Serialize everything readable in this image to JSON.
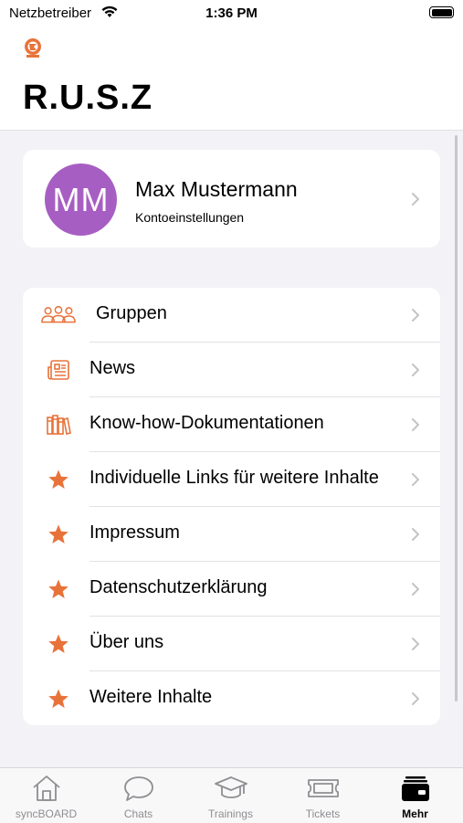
{
  "status_bar": {
    "carrier": "Netzbetreiber",
    "time": "1:36 PM"
  },
  "header": {
    "title": "R.U.S.Z"
  },
  "profile": {
    "initials": "MM",
    "name": "Max Mustermann",
    "subtitle": "Kontoeinstellungen",
    "avatar_color": "#a75ec2"
  },
  "menu": {
    "accent_color": "#e8733a",
    "items": [
      {
        "label": "Gruppen",
        "icon": "groups-icon"
      },
      {
        "label": "News",
        "icon": "newspaper-icon"
      },
      {
        "label": "Know-how-Dokumentationen",
        "icon": "books-icon"
      },
      {
        "label": "Individuelle Links für weitere Inhalte",
        "icon": "star-icon"
      },
      {
        "label": "Impressum",
        "icon": "star-icon"
      },
      {
        "label": "Datenschutzerklärung",
        "icon": "star-icon"
      },
      {
        "label": "Über uns",
        "icon": "star-icon"
      },
      {
        "label": "Weitere Inhalte",
        "icon": "star-icon"
      }
    ]
  },
  "tabbar": {
    "active": "Mehr",
    "tabs": [
      {
        "label": "syncBOARD",
        "icon": "home-icon"
      },
      {
        "label": "Chats",
        "icon": "chat-bubble-icon"
      },
      {
        "label": "Trainings",
        "icon": "graduation-cap-icon"
      },
      {
        "label": "Tickets",
        "icon": "ticket-icon"
      },
      {
        "label": "Mehr",
        "icon": "wallet-icon"
      }
    ]
  }
}
